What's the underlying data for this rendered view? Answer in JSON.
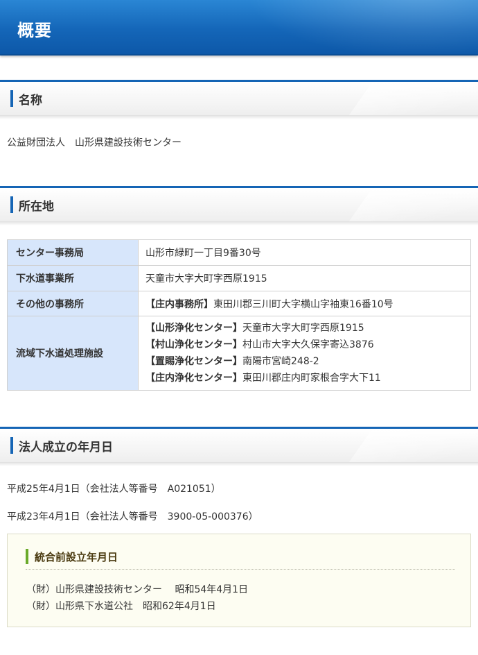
{
  "page": {
    "title": "概要"
  },
  "sections": {
    "name": {
      "heading": "名称",
      "text": "公益財団法人　山形県建設技術センター"
    },
    "location": {
      "heading": "所在地",
      "rows": [
        {
          "label": "センター事務局",
          "value": "山形市緑町一丁目9番30号"
        },
        {
          "label": "下水道事業所",
          "value": "天童市大字大町字西原1915"
        },
        {
          "label": "その他の事務所",
          "value_label": "【庄内事務所】",
          "value": "東田川郡三川町大字横山字袖東16番10号"
        },
        {
          "label": "流域下水道処理施設",
          "facilities": [
            {
              "name": "【山形浄化センター】",
              "address": "天童市大字大町字西原1915"
            },
            {
              "name": "【村山浄化センター】",
              "address": "村山市大字大久保字寄込3876"
            },
            {
              "name": "【置賜浄化センター】",
              "address": "南陽市宮崎248-2"
            },
            {
              "name": "【庄内浄化センター】",
              "address": "東田川郡庄内町家根合字大下11"
            }
          ]
        }
      ]
    },
    "established": {
      "heading": "法人成立の年月日",
      "lines": [
        "平成25年4月1日（会社法人等番号　A021051）",
        "平成23年4月1日（会社法人等番号　3900-05-000376）"
      ],
      "pre_merger": {
        "heading": "統合前設立年月日",
        "lines": [
          "（財）山形県建設技術センター　 昭和54年4月1日",
          "（財）山形県下水道公社　昭和62年4月1日"
        ]
      }
    }
  },
  "colors": {
    "header_blue": "#1466b8",
    "section_accent": "#1565b5",
    "table_header_bg": "#d7e6fb",
    "green_accent": "#6aaa2a"
  }
}
